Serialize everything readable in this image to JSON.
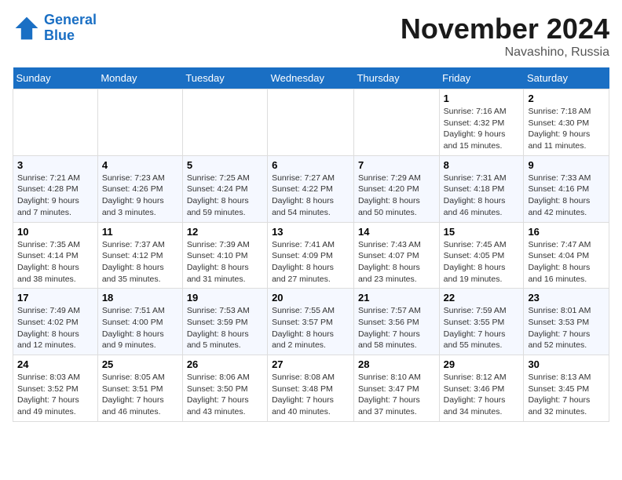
{
  "logo": {
    "line1": "General",
    "line2": "Blue"
  },
  "title": "November 2024",
  "location": "Navashino, Russia",
  "weekdays": [
    "Sunday",
    "Monday",
    "Tuesday",
    "Wednesday",
    "Thursday",
    "Friday",
    "Saturday"
  ],
  "weeks": [
    [
      {
        "day": "",
        "info": ""
      },
      {
        "day": "",
        "info": ""
      },
      {
        "day": "",
        "info": ""
      },
      {
        "day": "",
        "info": ""
      },
      {
        "day": "",
        "info": ""
      },
      {
        "day": "1",
        "info": "Sunrise: 7:16 AM\nSunset: 4:32 PM\nDaylight: 9 hours and 15 minutes."
      },
      {
        "day": "2",
        "info": "Sunrise: 7:18 AM\nSunset: 4:30 PM\nDaylight: 9 hours and 11 minutes."
      }
    ],
    [
      {
        "day": "3",
        "info": "Sunrise: 7:21 AM\nSunset: 4:28 PM\nDaylight: 9 hours and 7 minutes."
      },
      {
        "day": "4",
        "info": "Sunrise: 7:23 AM\nSunset: 4:26 PM\nDaylight: 9 hours and 3 minutes."
      },
      {
        "day": "5",
        "info": "Sunrise: 7:25 AM\nSunset: 4:24 PM\nDaylight: 8 hours and 59 minutes."
      },
      {
        "day": "6",
        "info": "Sunrise: 7:27 AM\nSunset: 4:22 PM\nDaylight: 8 hours and 54 minutes."
      },
      {
        "day": "7",
        "info": "Sunrise: 7:29 AM\nSunset: 4:20 PM\nDaylight: 8 hours and 50 minutes."
      },
      {
        "day": "8",
        "info": "Sunrise: 7:31 AM\nSunset: 4:18 PM\nDaylight: 8 hours and 46 minutes."
      },
      {
        "day": "9",
        "info": "Sunrise: 7:33 AM\nSunset: 4:16 PM\nDaylight: 8 hours and 42 minutes."
      }
    ],
    [
      {
        "day": "10",
        "info": "Sunrise: 7:35 AM\nSunset: 4:14 PM\nDaylight: 8 hours and 38 minutes."
      },
      {
        "day": "11",
        "info": "Sunrise: 7:37 AM\nSunset: 4:12 PM\nDaylight: 8 hours and 35 minutes."
      },
      {
        "day": "12",
        "info": "Sunrise: 7:39 AM\nSunset: 4:10 PM\nDaylight: 8 hours and 31 minutes."
      },
      {
        "day": "13",
        "info": "Sunrise: 7:41 AM\nSunset: 4:09 PM\nDaylight: 8 hours and 27 minutes."
      },
      {
        "day": "14",
        "info": "Sunrise: 7:43 AM\nSunset: 4:07 PM\nDaylight: 8 hours and 23 minutes."
      },
      {
        "day": "15",
        "info": "Sunrise: 7:45 AM\nSunset: 4:05 PM\nDaylight: 8 hours and 19 minutes."
      },
      {
        "day": "16",
        "info": "Sunrise: 7:47 AM\nSunset: 4:04 PM\nDaylight: 8 hours and 16 minutes."
      }
    ],
    [
      {
        "day": "17",
        "info": "Sunrise: 7:49 AM\nSunset: 4:02 PM\nDaylight: 8 hours and 12 minutes."
      },
      {
        "day": "18",
        "info": "Sunrise: 7:51 AM\nSunset: 4:00 PM\nDaylight: 8 hours and 9 minutes."
      },
      {
        "day": "19",
        "info": "Sunrise: 7:53 AM\nSunset: 3:59 PM\nDaylight: 8 hours and 5 minutes."
      },
      {
        "day": "20",
        "info": "Sunrise: 7:55 AM\nSunset: 3:57 PM\nDaylight: 8 hours and 2 minutes."
      },
      {
        "day": "21",
        "info": "Sunrise: 7:57 AM\nSunset: 3:56 PM\nDaylight: 7 hours and 58 minutes."
      },
      {
        "day": "22",
        "info": "Sunrise: 7:59 AM\nSunset: 3:55 PM\nDaylight: 7 hours and 55 minutes."
      },
      {
        "day": "23",
        "info": "Sunrise: 8:01 AM\nSunset: 3:53 PM\nDaylight: 7 hours and 52 minutes."
      }
    ],
    [
      {
        "day": "24",
        "info": "Sunrise: 8:03 AM\nSunset: 3:52 PM\nDaylight: 7 hours and 49 minutes."
      },
      {
        "day": "25",
        "info": "Sunrise: 8:05 AM\nSunset: 3:51 PM\nDaylight: 7 hours and 46 minutes."
      },
      {
        "day": "26",
        "info": "Sunrise: 8:06 AM\nSunset: 3:50 PM\nDaylight: 7 hours and 43 minutes."
      },
      {
        "day": "27",
        "info": "Sunrise: 8:08 AM\nSunset: 3:48 PM\nDaylight: 7 hours and 40 minutes."
      },
      {
        "day": "28",
        "info": "Sunrise: 8:10 AM\nSunset: 3:47 PM\nDaylight: 7 hours and 37 minutes."
      },
      {
        "day": "29",
        "info": "Sunrise: 8:12 AM\nSunset: 3:46 PM\nDaylight: 7 hours and 34 minutes."
      },
      {
        "day": "30",
        "info": "Sunrise: 8:13 AM\nSunset: 3:45 PM\nDaylight: 7 hours and 32 minutes."
      }
    ]
  ]
}
